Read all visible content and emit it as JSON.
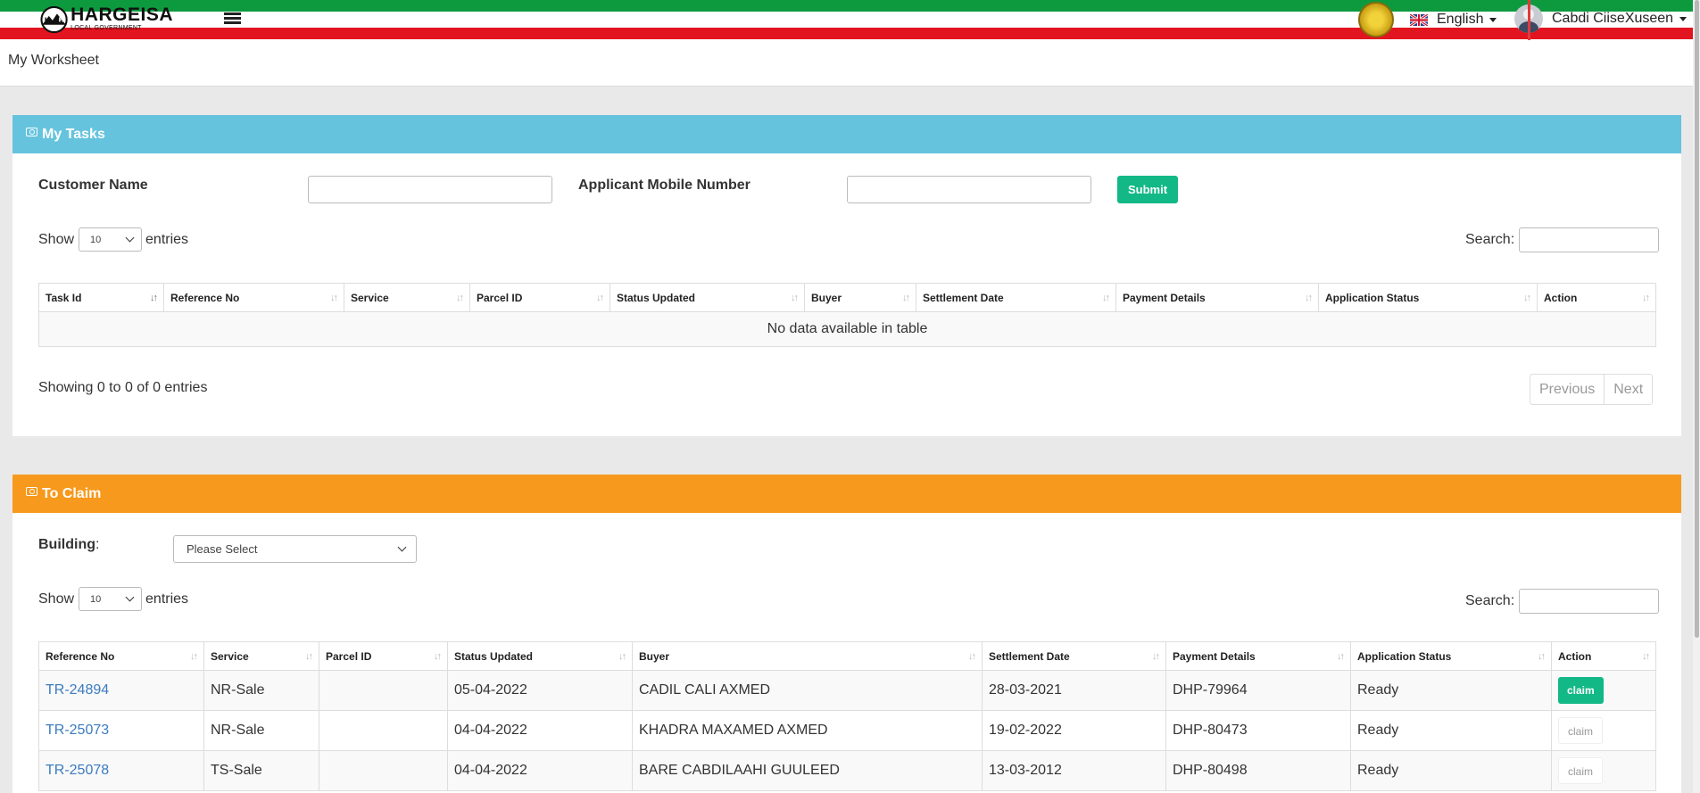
{
  "header": {
    "logo_title": "HARGEISA",
    "logo_subtitle": "LOCAL GOVERNMENT",
    "language": "English",
    "user_name": "Cabdi CiiseXuseen"
  },
  "page_title": "My Worksheet",
  "tasks_panel": {
    "title": "My Tasks",
    "customer_name_label": "Customer Name",
    "mobile_label": "Applicant Mobile Number",
    "submit_label": "Submit",
    "show_label": "Show",
    "entries_value": "10",
    "entries_label": "entries",
    "search_label": "Search:",
    "columns": [
      "Task Id",
      "Reference No",
      "Service",
      "Parcel ID",
      "Status Updated",
      "Buyer",
      "Settlement Date",
      "Payment Details",
      "Application Status",
      "Action"
    ],
    "empty_message": "No data available in table",
    "info": "Showing 0 to 0 of 0 entries",
    "prev_label": "Previous",
    "next_label": "Next"
  },
  "claim_panel": {
    "title": "To Claim",
    "building_label": "Building",
    "building_colon": ":",
    "building_placeholder": "Please Select",
    "show_label": "Show",
    "entries_value": "10",
    "entries_label": "entries",
    "search_label": "Search:",
    "columns": [
      "Reference No",
      "Service",
      "Parcel ID",
      "Status Updated",
      "Buyer",
      "Settlement Date",
      "Payment Details",
      "Application Status",
      "Action"
    ],
    "rows": [
      {
        "ref": "TR-24894",
        "service": "NR-Sale",
        "parcel": "",
        "status_updated": "05-04-2022",
        "buyer": "CADIL CALI AXMED",
        "settlement": "28-03-2021",
        "payment": "DHP-79964",
        "app_status": "Ready",
        "action": "claim"
      },
      {
        "ref": "TR-25073",
        "service": "NR-Sale",
        "parcel": "",
        "status_updated": "04-04-2022",
        "buyer": "KHADRA MAXAMED AXMED",
        "settlement": "19-02-2022",
        "payment": "DHP-80473",
        "app_status": "Ready",
        "action": "claim"
      },
      {
        "ref": "TR-25078",
        "service": "TS-Sale",
        "parcel": "",
        "status_updated": "04-04-2022",
        "buyer": "BARE CABDILAAHI GUULEED",
        "settlement": "13-03-2012",
        "payment": "DHP-80498",
        "app_status": "Ready",
        "action": "claim"
      }
    ]
  },
  "colors": {
    "flag_green": "#0d9a3f",
    "flag_red": "#e1141f",
    "tasks_header": "#66c3de",
    "claim_header": "#f7991c",
    "accent_button": "#12b886",
    "link": "#3b7bbf"
  }
}
